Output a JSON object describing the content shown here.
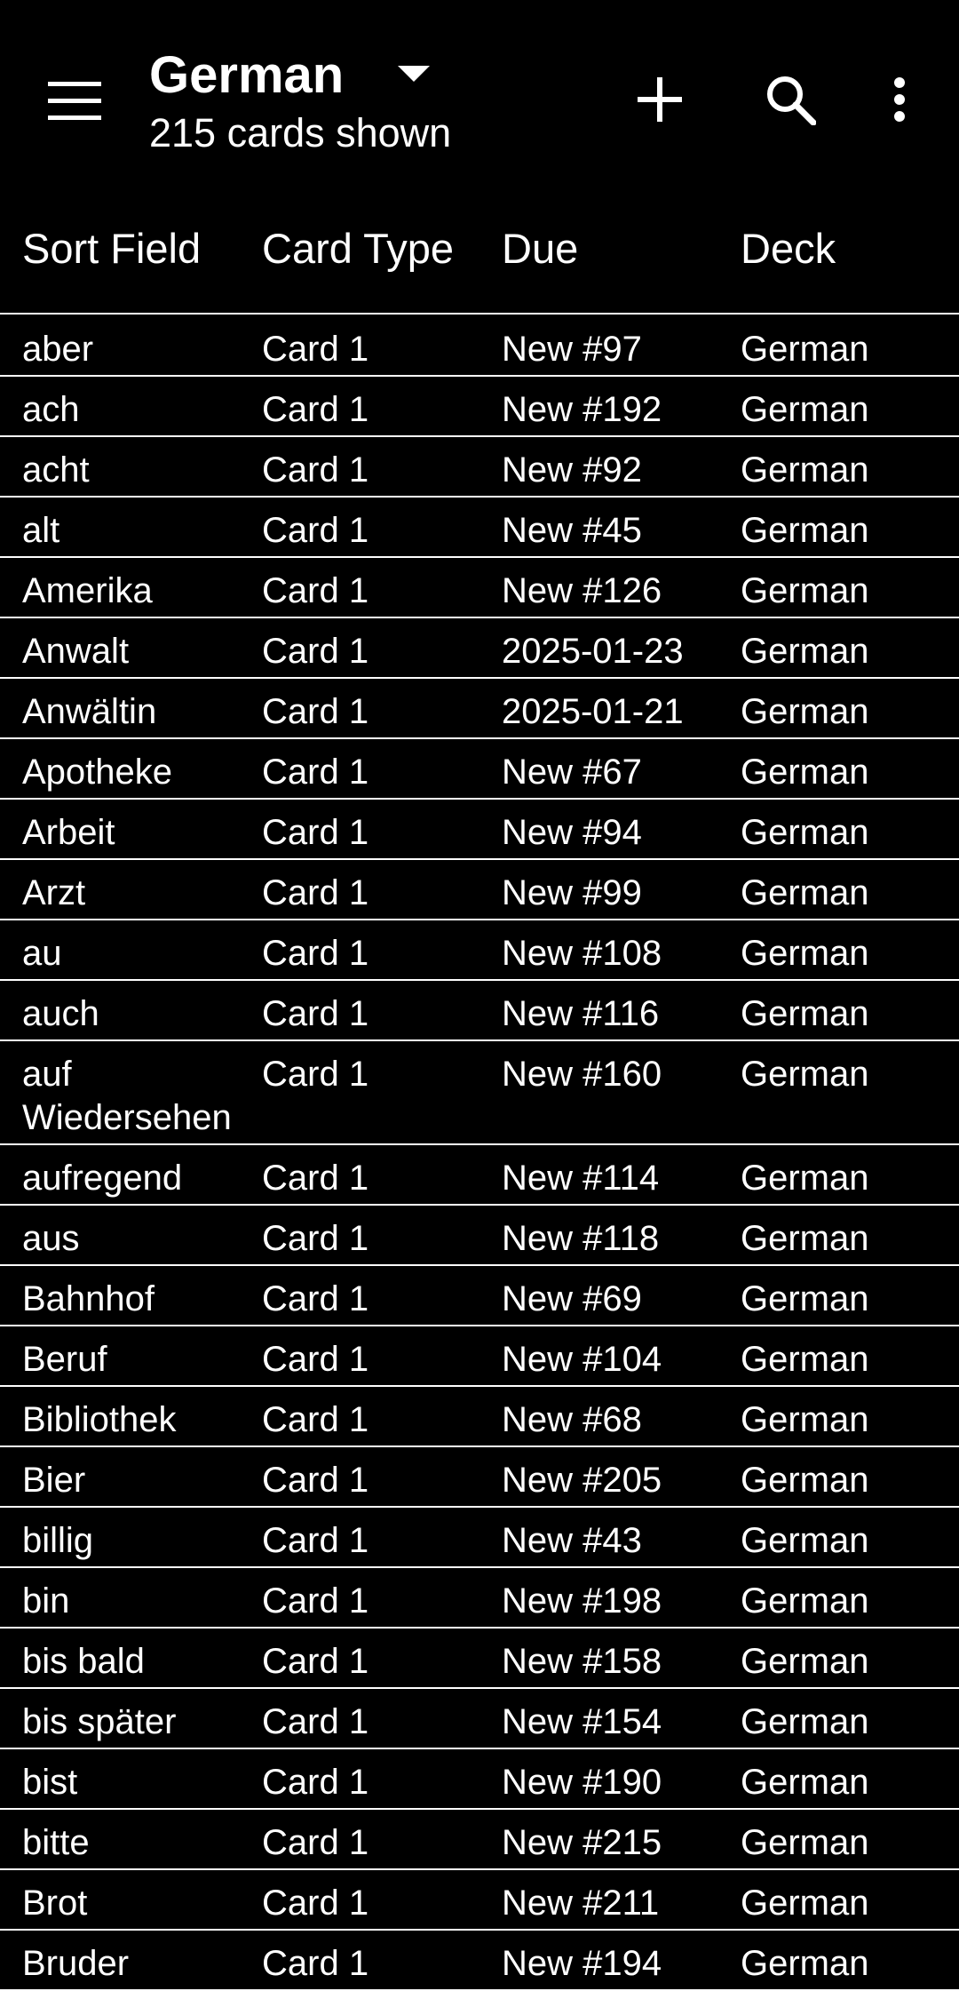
{
  "toolbar": {
    "title": "German",
    "subtitle": "215 cards shown",
    "icons": {
      "menu": "hamburger-menu-icon",
      "dropdown": "caret-down-icon",
      "add": "plus-icon",
      "search": "magnifier-icon",
      "more": "vertical-ellipsis-icon"
    }
  },
  "table": {
    "columns": [
      "Sort Field",
      "Card Type",
      "Due",
      "Deck"
    ],
    "rows": [
      {
        "sort_field": "aber",
        "card_type": "Card 1",
        "due": "New #97",
        "deck": "German"
      },
      {
        "sort_field": "ach",
        "card_type": "Card 1",
        "due": "New #192",
        "deck": "German"
      },
      {
        "sort_field": "acht",
        "card_type": "Card 1",
        "due": "New #92",
        "deck": "German"
      },
      {
        "sort_field": "alt",
        "card_type": "Card 1",
        "due": "New #45",
        "deck": "German"
      },
      {
        "sort_field": "Amerika",
        "card_type": "Card 1",
        "due": "New #126",
        "deck": "German"
      },
      {
        "sort_field": "Anwalt",
        "card_type": "Card 1",
        "due": "2025-01-23",
        "deck": "German"
      },
      {
        "sort_field": "Anwältin",
        "card_type": "Card 1",
        "due": "2025-01-21",
        "deck": "German"
      },
      {
        "sort_field": "Apotheke",
        "card_type": "Card 1",
        "due": "New #67",
        "deck": "German"
      },
      {
        "sort_field": "Arbeit",
        "card_type": "Card 1",
        "due": "New #94",
        "deck": "German"
      },
      {
        "sort_field": "Arzt",
        "card_type": "Card 1",
        "due": "New #99",
        "deck": "German"
      },
      {
        "sort_field": "au",
        "card_type": "Card 1",
        "due": "New #108",
        "deck": "German"
      },
      {
        "sort_field": "auch",
        "card_type": "Card 1",
        "due": "New #116",
        "deck": "German"
      },
      {
        "sort_field": "auf Wiedersehen",
        "card_type": "Card 1",
        "due": "New #160",
        "deck": "German"
      },
      {
        "sort_field": "aufregend",
        "card_type": "Card 1",
        "due": "New #114",
        "deck": "German"
      },
      {
        "sort_field": "aus",
        "card_type": "Card 1",
        "due": "New #118",
        "deck": "German"
      },
      {
        "sort_field": "Bahnhof",
        "card_type": "Card 1",
        "due": "New #69",
        "deck": "German"
      },
      {
        "sort_field": "Beruf",
        "card_type": "Card 1",
        "due": "New #104",
        "deck": "German"
      },
      {
        "sort_field": "Bibliothek",
        "card_type": "Card 1",
        "due": "New #68",
        "deck": "German"
      },
      {
        "sort_field": "Bier",
        "card_type": "Card 1",
        "due": "New #205",
        "deck": "German"
      },
      {
        "sort_field": "billig",
        "card_type": "Card 1",
        "due": "New #43",
        "deck": "German"
      },
      {
        "sort_field": "bin",
        "card_type": "Card 1",
        "due": "New #198",
        "deck": "German"
      },
      {
        "sort_field": "bis bald",
        "card_type": "Card 1",
        "due": "New #158",
        "deck": "German"
      },
      {
        "sort_field": "bis später",
        "card_type": "Card 1",
        "due": "New #154",
        "deck": "German"
      },
      {
        "sort_field": "bist",
        "card_type": "Card 1",
        "due": "New #190",
        "deck": "German"
      },
      {
        "sort_field": "bitte",
        "card_type": "Card 1",
        "due": "New #215",
        "deck": "German"
      },
      {
        "sort_field": "Brot",
        "card_type": "Card 1",
        "due": "New #211",
        "deck": "German"
      },
      {
        "sort_field": "Bruder",
        "card_type": "Card 1",
        "due": "New #194",
        "deck": "German"
      }
    ]
  },
  "colors": {
    "background": "#000000",
    "text": "#ffffff",
    "divider": "#ffffff"
  }
}
